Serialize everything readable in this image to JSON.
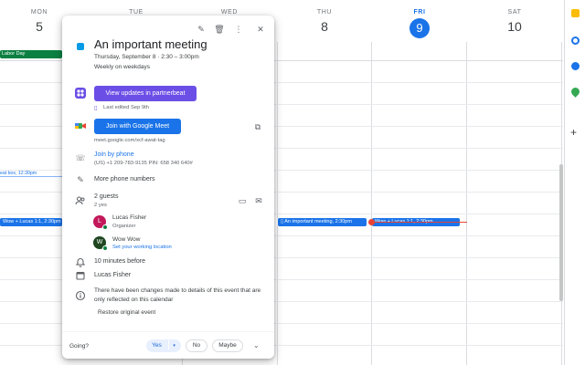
{
  "week": {
    "days": [
      {
        "name": "MON",
        "num": "5"
      },
      {
        "name": "TUE",
        "num": ""
      },
      {
        "name": "WED",
        "num": ""
      },
      {
        "name": "THU",
        "num": "8"
      },
      {
        "name": "FRI",
        "num": "9"
      },
      {
        "name": "SAT",
        "num": "10"
      }
    ],
    "allday_event": "Labor Day",
    "events": {
      "mon_outline": "eat box, 12:30pm",
      "mon_chip": "Wow + Lucas 1:1, 2:30pm",
      "thu_chip": "An important meeting, 2:30pm",
      "fri_chip": "Wow + Lucas 1:1, 2:30pm"
    }
  },
  "colors": {
    "today": "#1a73e8",
    "event_blue": "#1a73e8",
    "allday_green": "#0b8043",
    "partnerbeat_purple": "#6b4ee6",
    "now_line": "#ea4335"
  },
  "popup": {
    "title": "An important meeting",
    "datetime": "Thursday, September 8  ·  2:30 – 3:00pm",
    "recurrence": "Weekly on weekdays",
    "partnerbeat_button": "View updates in partnerbeat",
    "last_edited": "Last edited Sep 9th",
    "meet_button": "Join with Google Meet",
    "meet_link": "meet.google.com/xcf-awat-tag",
    "phone_label": "Join by phone",
    "phone_number": "(US) +1 209-783-9135 PIN: 658 340 640#",
    "more_phones": "More phone numbers",
    "guests_count": "2 guests",
    "guests_yes": "2 yes",
    "guests": [
      {
        "initial": "L",
        "name": "Lucas Fisher",
        "note": "Organizer"
      },
      {
        "initial": "W",
        "name": "Wow Wow",
        "note": "Set your working location"
      }
    ],
    "reminder": "10 minutes before",
    "calendar_owner": "Lucas Fisher",
    "notice": "There have been changes made to details of this event that are only reflected on this calendar",
    "restore": "Restore original event",
    "footer": {
      "going": "Going?",
      "yes": "Yes",
      "no": "No",
      "maybe": "Maybe"
    }
  },
  "icons": [
    "edit-icon",
    "delete-icon",
    "more-vert-icon",
    "close-icon",
    "partnerbeat-icon",
    "file-icon",
    "meet-icon",
    "copy-icon",
    "phone-icon",
    "edit-note-icon",
    "people-icon",
    "chat-icon",
    "email-icon",
    "bell-icon",
    "calendar-icon",
    "info-icon",
    "chevron-down-icon",
    "check-icon"
  ]
}
